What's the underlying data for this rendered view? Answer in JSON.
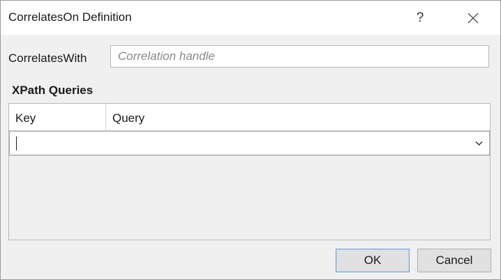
{
  "window": {
    "title": "CorrelatesOn Definition",
    "help_label": "?",
    "close_icon": "close-icon"
  },
  "form": {
    "correlates_with_label": "CorrelatesWith",
    "correlates_with_value": "",
    "correlates_with_placeholder": "Correlation handle"
  },
  "xpath": {
    "section_title": "XPath Queries",
    "columns": [
      "Key",
      "Query"
    ],
    "rows": [
      {
        "value": ""
      }
    ]
  },
  "buttons": {
    "ok": "OK",
    "cancel": "Cancel"
  },
  "colors": {
    "background": "#f0f0f0",
    "titlebar": "#ffffff",
    "default_button_border": "#7a9ccf"
  }
}
